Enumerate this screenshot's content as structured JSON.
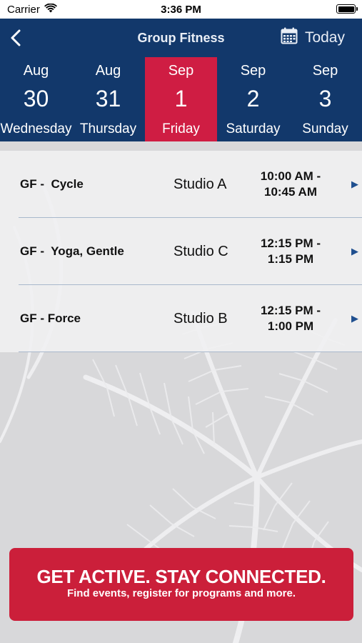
{
  "status": {
    "carrier": "Carrier",
    "time": "3:36 PM"
  },
  "nav": {
    "title": "Group Fitness",
    "today_label": "Today"
  },
  "days": [
    {
      "month": "Aug",
      "day": "30",
      "weekday": "Wednesday"
    },
    {
      "month": "Aug",
      "day": "31",
      "weekday": "Thursday"
    },
    {
      "month": "Sep",
      "day": "1",
      "weekday": "Friday"
    },
    {
      "month": "Sep",
      "day": "2",
      "weekday": "Saturday"
    },
    {
      "month": "Sep",
      "day": "3",
      "weekday": "Sunday"
    }
  ],
  "selected_day": "Friday",
  "classes": [
    {
      "name": "GF -  Cycle",
      "studio": "Studio A",
      "time_start": "10:00 AM -",
      "time_end": "10:45 AM"
    },
    {
      "name": "GF -  Yoga, Gentle",
      "studio": "Studio C",
      "time_start": "12:15 PM -",
      "time_end": "1:15 PM"
    },
    {
      "name": "GF - Force",
      "studio": "Studio B",
      "time_start": "12:15 PM -",
      "time_end": "1:00 PM"
    }
  ],
  "banner": {
    "title": "GET ACTIVE.  STAY CONNECTED.",
    "subtitle": "Find events, register for programs and more."
  },
  "colors": {
    "navy": "#12386b",
    "accent_red": "#cf1d43",
    "banner_red": "#cb1f3a"
  },
  "icons": [
    "wifi-icon",
    "battery-icon",
    "back-chevron-icon",
    "calendar-icon",
    "chevron-right-icon"
  ]
}
